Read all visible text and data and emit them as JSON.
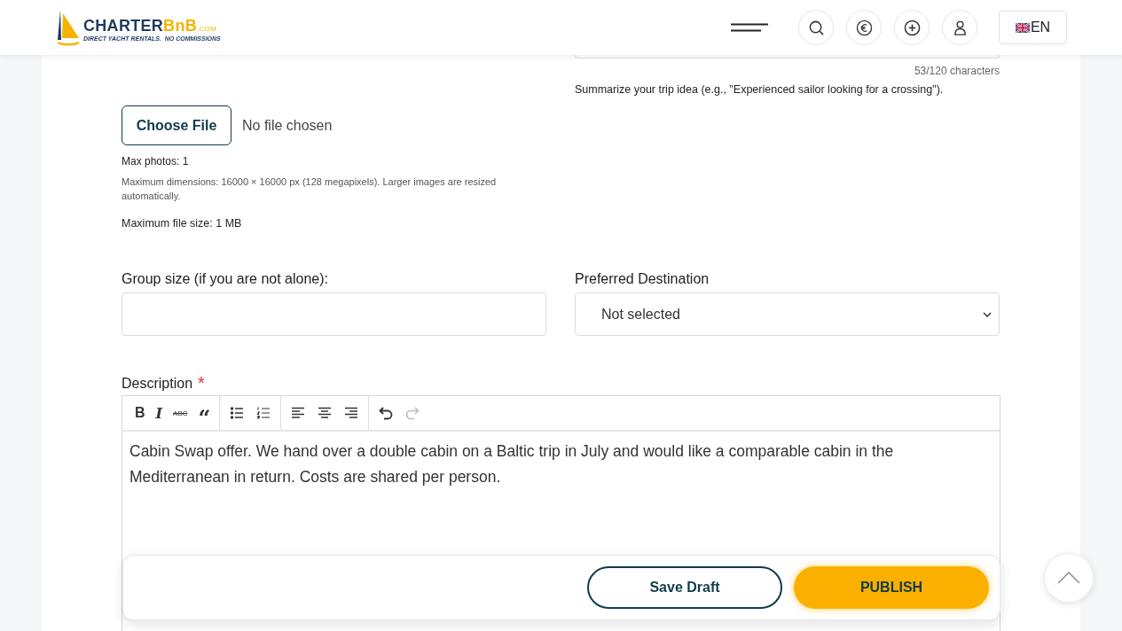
{
  "header": {
    "logo": {
      "name_main": "CHARTER",
      "name_accent": "BnB",
      "domain": ".COM",
      "tagline": "DIRECT YACHT RENTALS.  NO COMMISSIONS"
    },
    "language": "EN"
  },
  "title_field": {
    "counter": "53/120 characters",
    "hint": "Summarize your trip idea (e.g., \"Experienced sailor looking for a crossing\")."
  },
  "photo_upload": {
    "button": "Choose File",
    "status": "No file chosen",
    "notes": [
      {
        "kind": "plain",
        "text": "Max photos: 1"
      },
      {
        "kind": "muted",
        "text": "Maximum dimensions: 16000 × 16000 px (128 megapixels). Larger images are resized automatically."
      },
      {
        "kind": "strong",
        "text": "Maximum file size: 1 MB"
      }
    ]
  },
  "group_size": {
    "label": "Group size (if you are not alone):"
  },
  "destination": {
    "label": "Preferred Destination",
    "value": "Not selected"
  },
  "description": {
    "label": "Description",
    "required_mark": "*",
    "toolbar": [
      {
        "kind": "bold",
        "label": "B",
        "disabled": false
      },
      {
        "kind": "italic",
        "label": "I",
        "disabled": false
      },
      {
        "kind": "strike",
        "label": "ABC",
        "disabled": false
      },
      {
        "kind": "quote",
        "label": "“",
        "disabled": false
      },
      {
        "kind": "bullets",
        "disabled": false
      },
      {
        "kind": "numbers",
        "disabled": false
      },
      {
        "kind": "left",
        "disabled": false
      },
      {
        "kind": "center",
        "disabled": false
      },
      {
        "kind": "right",
        "disabled": false
      },
      {
        "kind": "undo",
        "disabled": false
      },
      {
        "kind": "redo",
        "disabled": true
      }
    ],
    "text": "Cabin Swap offer. We hand over a double cabin on a Baltic trip in July and would like a comparable cabin in the Mediterranean in return. Costs are shared per person."
  },
  "actions": [
    {
      "kind": "secondary",
      "label": "Save Draft"
    },
    {
      "kind": "primary",
      "label": "PUBLISH"
    }
  ]
}
